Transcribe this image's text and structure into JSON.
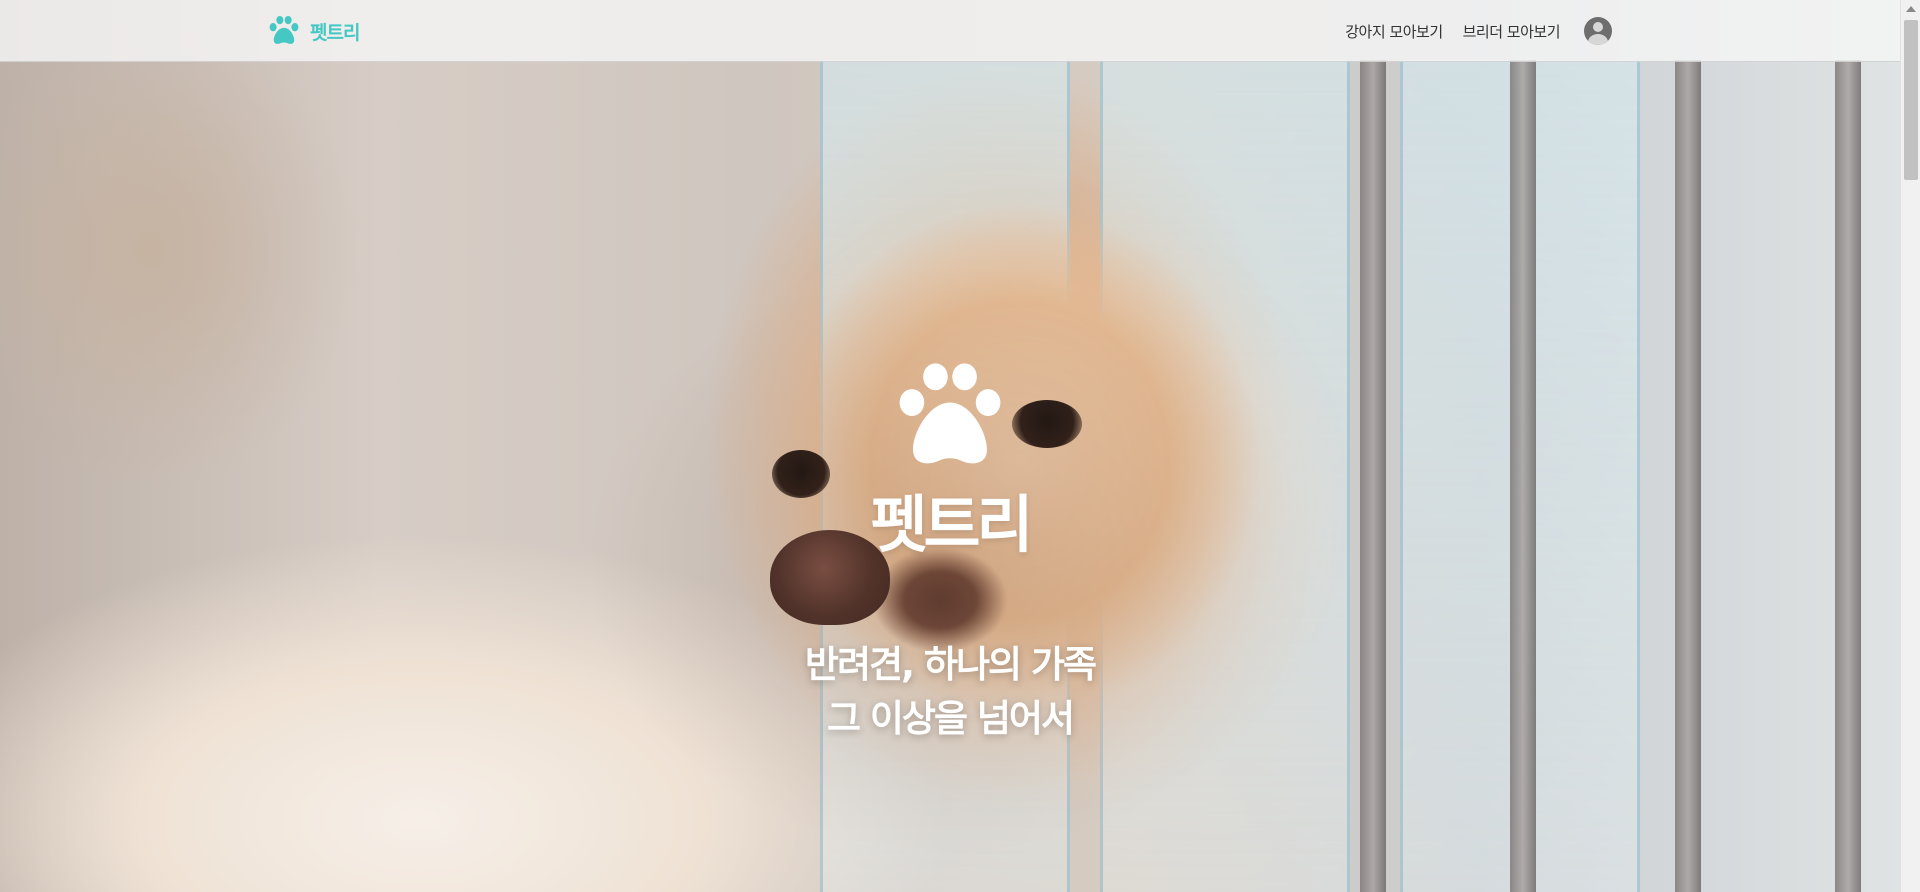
{
  "navbar": {
    "brand": {
      "icon": "paw-icon",
      "name": "펫트리",
      "color": "#45c8c4"
    },
    "links": [
      {
        "label": "강아지 모아보기"
      },
      {
        "label": "브리더 모아보기"
      }
    ],
    "profile_icon": "user-avatar-icon"
  },
  "hero": {
    "logo_icon": "paw-icon",
    "logo_text": "펫트리",
    "tagline_line1": "반려견, 하나의 가족",
    "tagline_line2": "그 이상을 넘어서"
  },
  "colors": {
    "accent": "#45c8c4",
    "hero_text": "#ffffff"
  }
}
